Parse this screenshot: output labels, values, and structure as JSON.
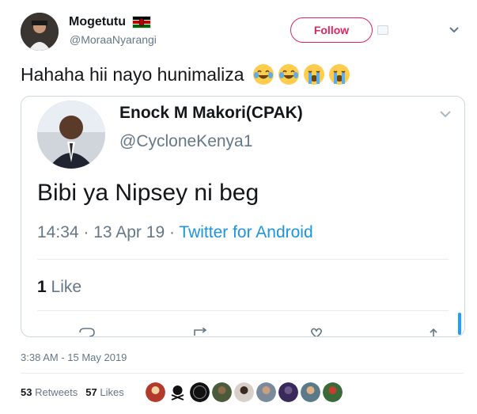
{
  "author": {
    "name": "Mogetutu",
    "handle": "@MoraaNyarangi"
  },
  "follow_label": "Follow",
  "tweet_text": "Hahaha hii nayo hunimaliza",
  "emojis": [
    "face-with-tears-of-joy",
    "face-with-tears-of-joy",
    "loudly-crying-face",
    "loudly-crying-face"
  ],
  "quoted": {
    "name": "Enock M Makori(CPAK)",
    "handle": "@CycloneKenya1",
    "text": "Bibi ya Nipsey ni beg",
    "time": "14:34 · 13 Apr 19 · ",
    "source": "Twitter for Android",
    "likes_count": "1",
    "likes_label": " Like"
  },
  "timestamp": "3:38 AM - 15 May 2019",
  "stats": {
    "retweets_count": "53",
    "retweets_label": " Retweets",
    "likes_count": "57",
    "likes_label": " Likes"
  },
  "colors": {
    "follow_accent": "#e0245e",
    "link_blue": "#1b95e0",
    "muted": "#657786"
  }
}
